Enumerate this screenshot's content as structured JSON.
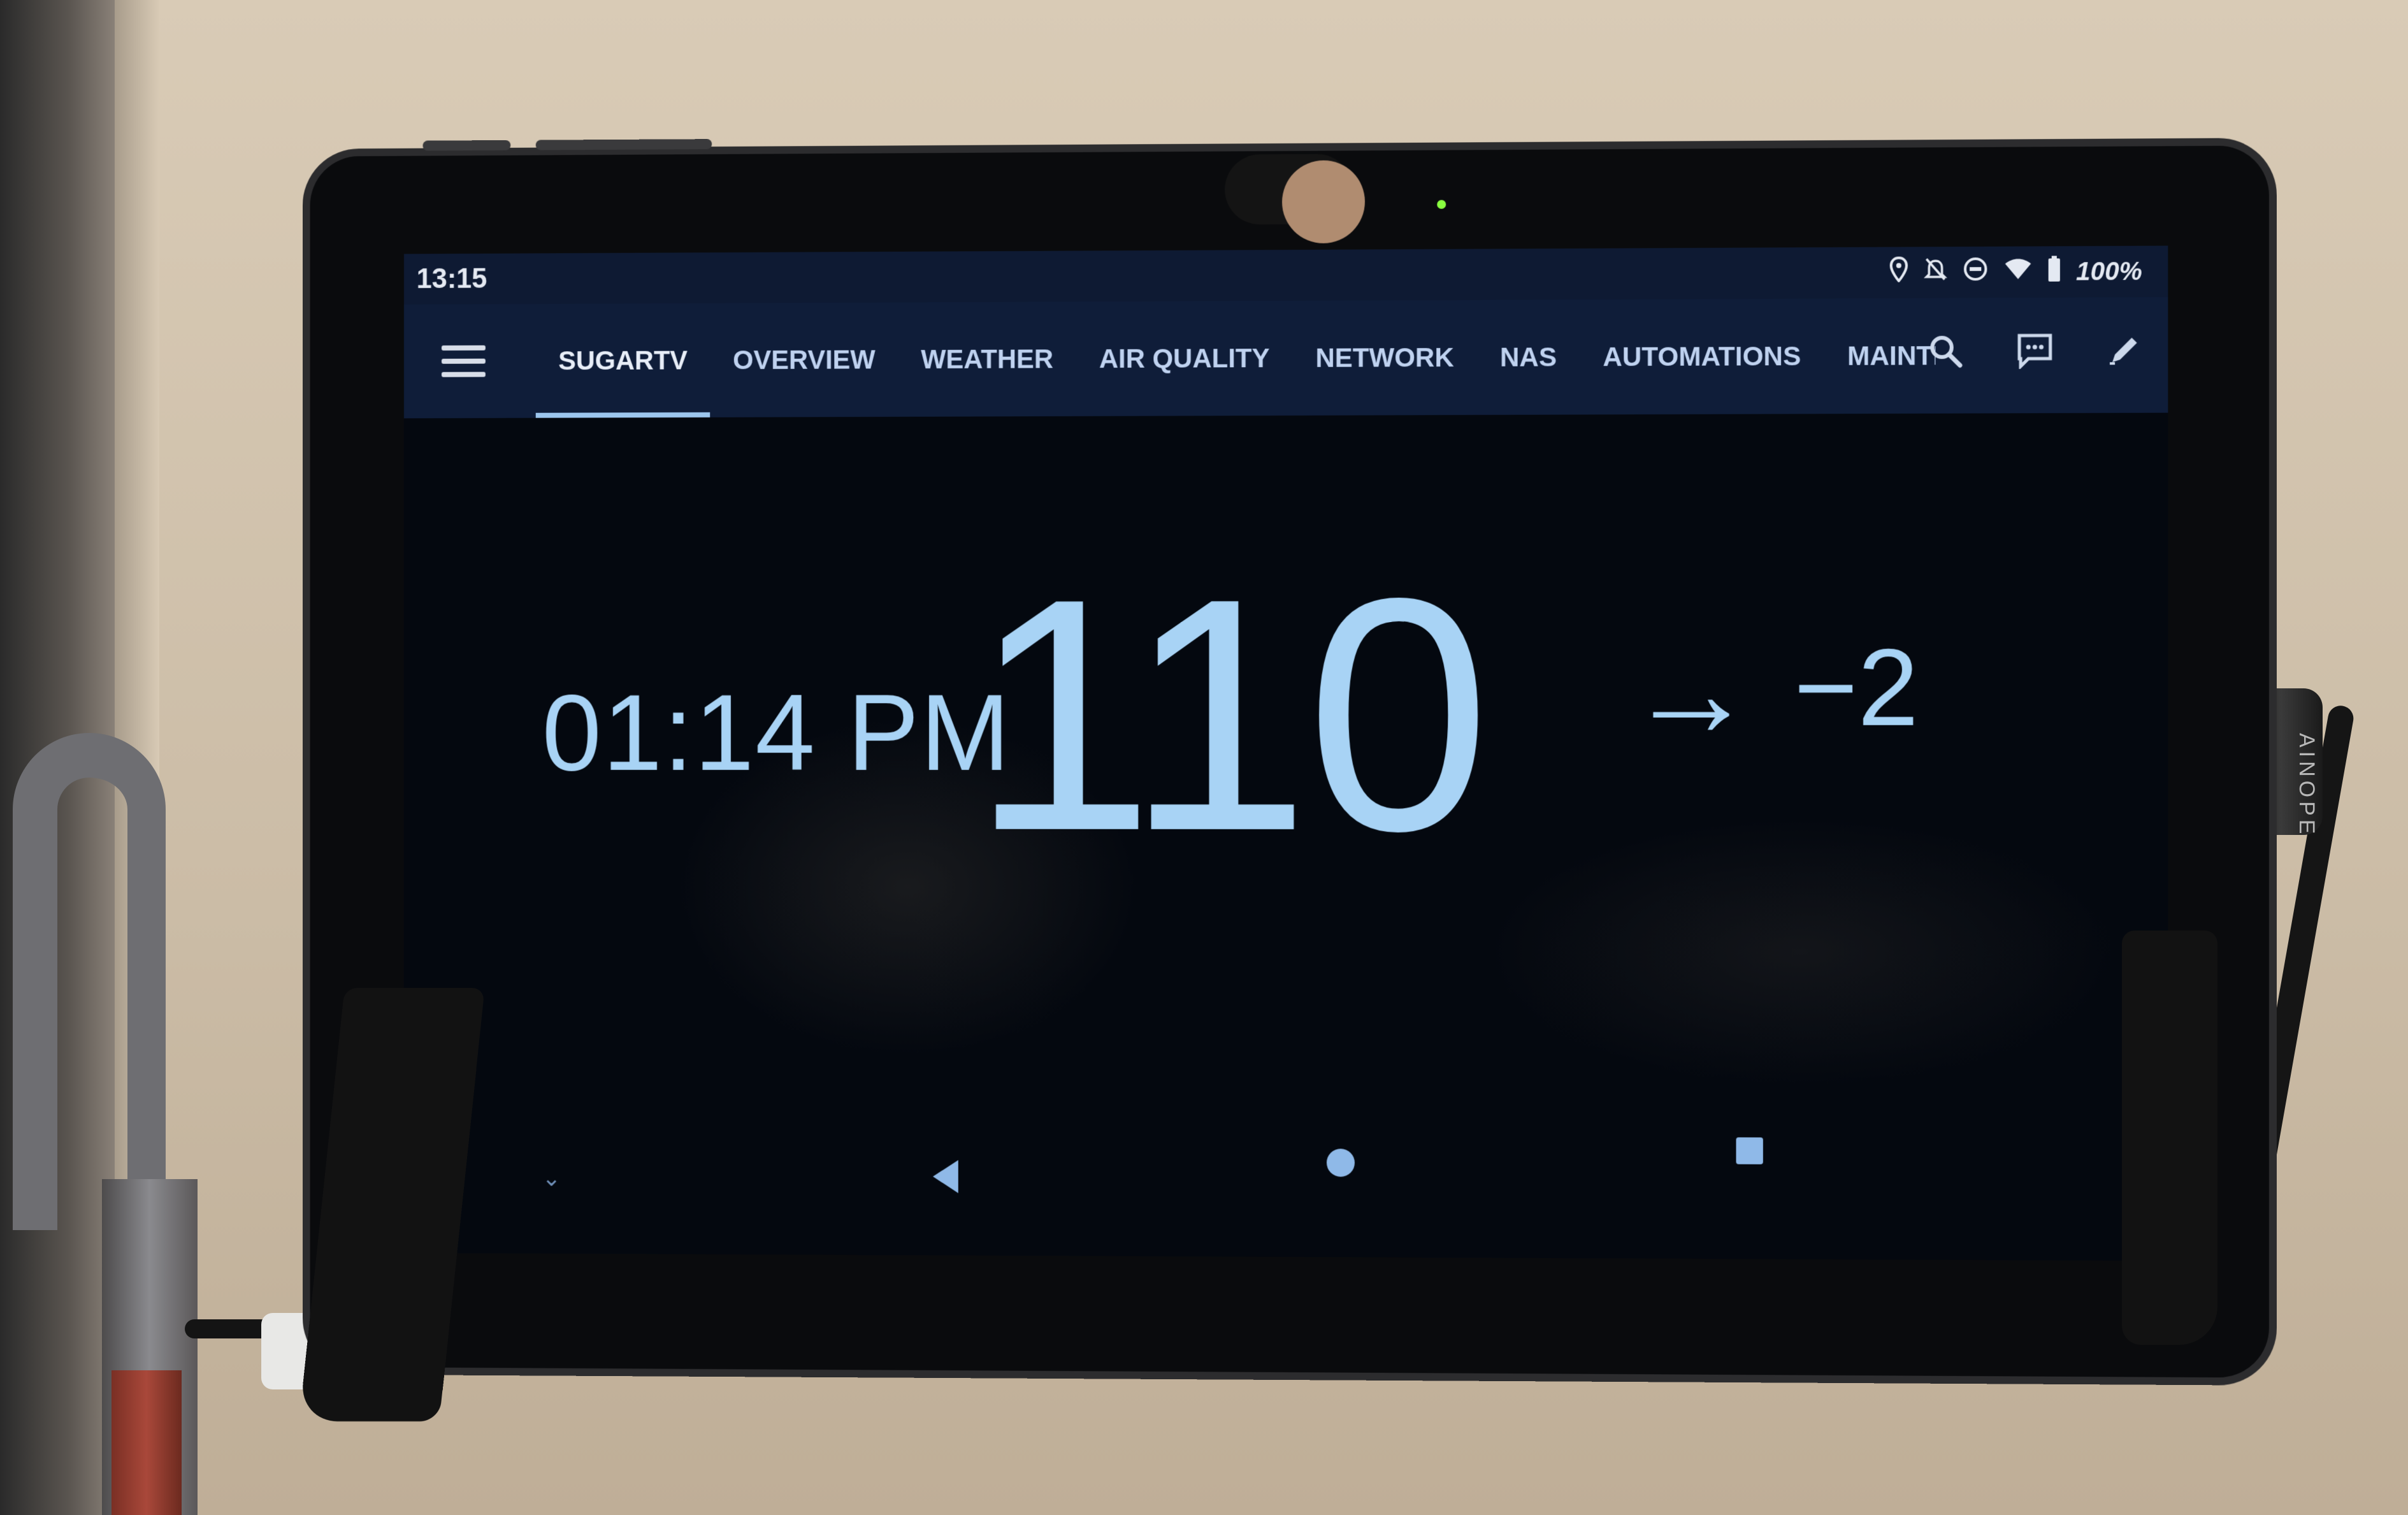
{
  "status_bar": {
    "time": "13:15",
    "battery": "100%",
    "icons": [
      "location-icon",
      "notifications-off-icon",
      "do-not-disturb-icon",
      "wifi-icon",
      "battery-icon"
    ]
  },
  "toolbar": {
    "tabs": [
      {
        "label": "SUGARTV",
        "active": true
      },
      {
        "label": "OVERVIEW"
      },
      {
        "label": "WEATHER"
      },
      {
        "label": "AIR QUALITY"
      },
      {
        "label": "NETWORK"
      },
      {
        "label": "NAS"
      },
      {
        "label": "AUTOMATIONS"
      },
      {
        "label": "MAINTENA"
      }
    ]
  },
  "clock": {
    "time": "01:14 PM",
    "value": "110",
    "arrow": "→",
    "delta": "−2"
  },
  "cable_brand": "AINOPE",
  "colors": {
    "toolbar_bg": "#0f1d39",
    "accent": "#a8d3f5",
    "screen_bg": "#04080f"
  }
}
